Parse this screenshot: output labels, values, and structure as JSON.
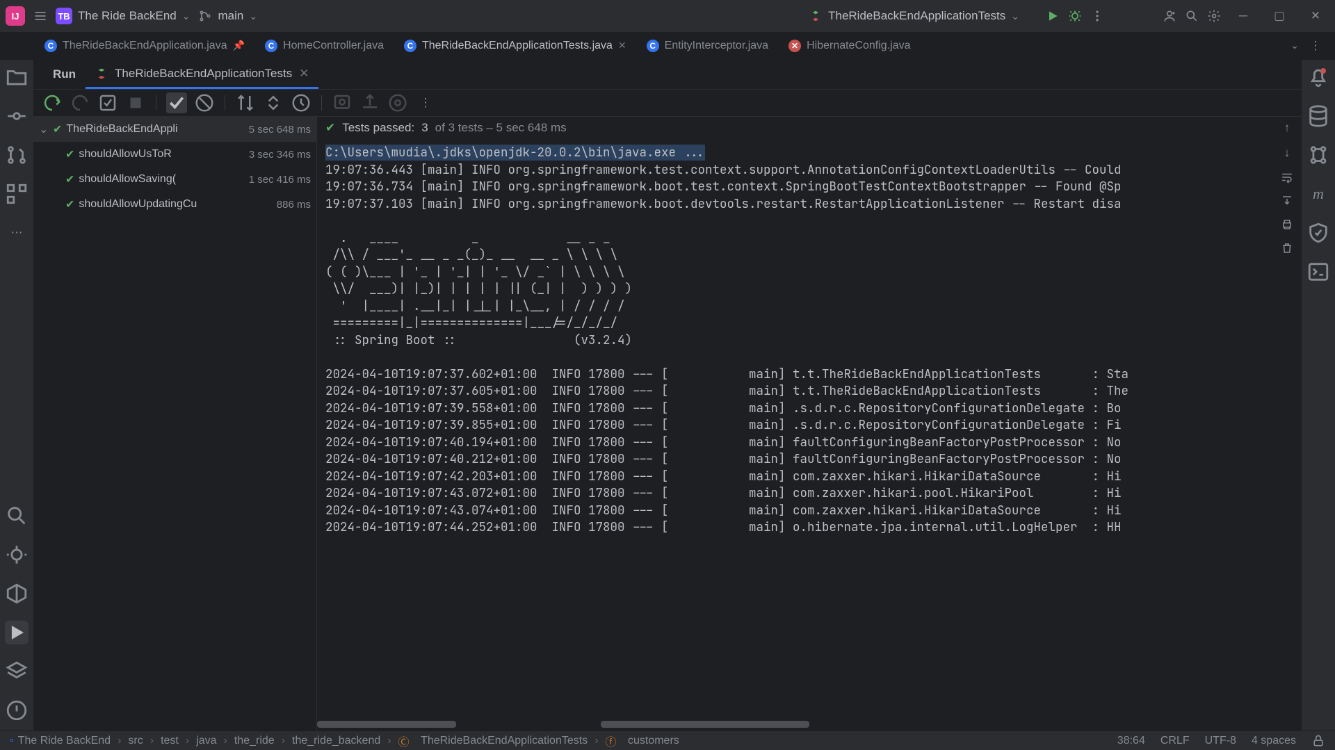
{
  "titlebar": {
    "logo_text": "IJ",
    "project_badge": "TB",
    "project_name": "The Ride BackEnd",
    "branch": "main",
    "run_config": "TheRideBackEndApplicationTests"
  },
  "editor_tabs": [
    {
      "label": "TheRideBackEndApplication.java",
      "icon": "c",
      "pinned": true
    },
    {
      "label": "HomeController.java",
      "icon": "c"
    },
    {
      "label": "TheRideBackEndApplicationTests.java",
      "icon": "c",
      "closeable": true,
      "active": true
    },
    {
      "label": "EntityInterceptor.java",
      "icon": "c"
    },
    {
      "label": "HibernateConfig.java",
      "icon": "x"
    }
  ],
  "run_tool": {
    "title": "Run",
    "config_tab": "TheRideBackEndApplicationTests"
  },
  "tests": {
    "summary_prefix": "Tests passed:",
    "summary_count": "3",
    "summary_suffix": "of 3 tests – 5 sec 648 ms",
    "root": {
      "name": "TheRideBackEndAppli",
      "time": "5 sec 648 ms"
    },
    "items": [
      {
        "name": "shouldAllowUsToR",
        "time": "3 sec 346 ms"
      },
      {
        "name": "shouldAllowSaving(",
        "time": "1 sec 416 ms"
      },
      {
        "name": "shouldAllowUpdatingCu",
        "time": "886 ms"
      }
    ]
  },
  "console_lines": [
    "C:\\Users\\mudia\\.jdks\\openjdk-20.0.2\\bin\\java.exe ...",
    "19:07:36.443 [main] INFO org.springframework.test.context.support.AnnotationConfigContextLoaderUtils -- Could",
    "19:07:36.734 [main] INFO org.springframework.boot.test.context.SpringBootTestContextBootstrapper -- Found @Sp",
    "19:07:37.103 [main] INFO org.springframework.boot.devtools.restart.RestartApplicationListener -- Restart disa",
    "",
    "  .   ____          _            __ _ _",
    " /\\\\ / ___'_ __ _ _(_)_ __  __ _ \\ \\ \\ \\",
    "( ( )\\___ | '_ | '_| | '_ \\/ _` | \\ \\ \\ \\",
    " \\\\/  ___)| |_)| | | | | || (_| |  ) ) ) )",
    "  '  |____| .__|_| |_|_| |_\\__, | / / / /",
    " =========|_|==============|___/=/_/_/_/",
    " :: Spring Boot ::                (v3.2.4)",
    "",
    "2024-04-10T19:07:37.602+01:00  INFO 17800 --- [           main] t.t.TheRideBackEndApplicationTests       : Sta",
    "2024-04-10T19:07:37.605+01:00  INFO 17800 --- [           main] t.t.TheRideBackEndApplicationTests       : The",
    "2024-04-10T19:07:39.558+01:00  INFO 17800 --- [           main] .s.d.r.c.RepositoryConfigurationDelegate : Bo",
    "2024-04-10T19:07:39.855+01:00  INFO 17800 --- [           main] .s.d.r.c.RepositoryConfigurationDelegate : Fi",
    "2024-04-10T19:07:40.194+01:00  INFO 17800 --- [           main] faultConfiguringBeanFactoryPostProcessor : No",
    "2024-04-10T19:07:40.212+01:00  INFO 17800 --- [           main] faultConfiguringBeanFactoryPostProcessor : No",
    "2024-04-10T19:07:42.203+01:00  INFO 17800 --- [           main] com.zaxxer.hikari.HikariDataSource       : Hi",
    "2024-04-10T19:07:43.072+01:00  INFO 17800 --- [           main] com.zaxxer.hikari.pool.HikariPool        : Hi",
    "2024-04-10T19:07:43.074+01:00  INFO 17800 --- [           main] com.zaxxer.hikari.HikariDataSource       : Hi",
    "2024-04-10T19:07:44.252+01:00  INFO 17800 --- [           main] o.hibernate.jpa.internal.util.LogHelper  : HH"
  ],
  "breadcrumbs": {
    "items": [
      "The Ride BackEnd",
      "src",
      "test",
      "java",
      "the_ride",
      "the_ride_backend",
      "TheRideBackEndApplicationTests",
      "customers"
    ]
  },
  "statusbar": {
    "line_col": "38:64",
    "line_sep": "CRLF",
    "encoding": "UTF-8",
    "indent": "4 spaces"
  }
}
